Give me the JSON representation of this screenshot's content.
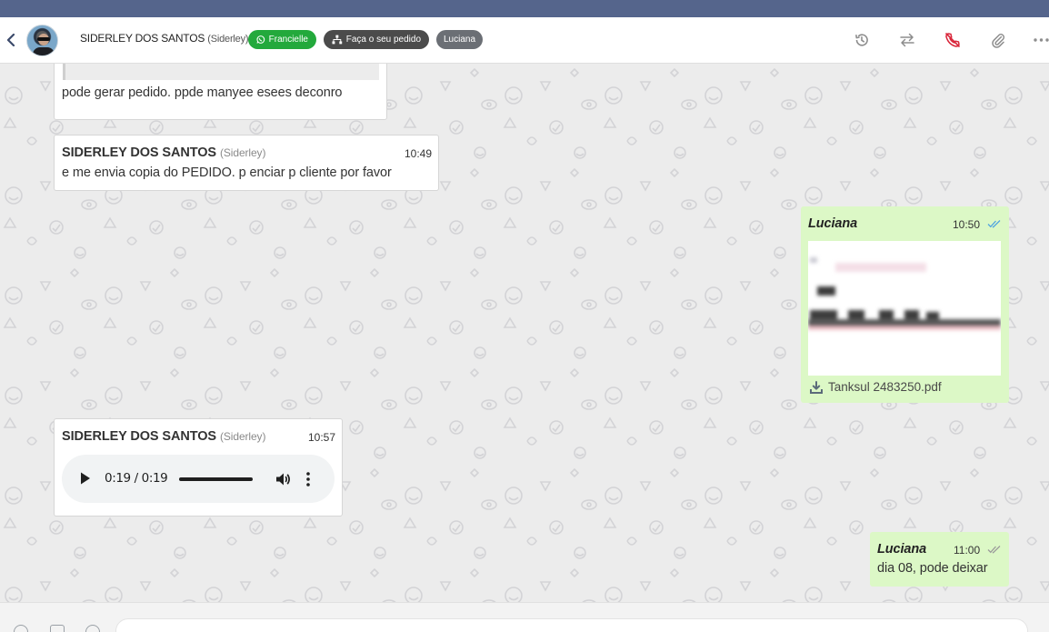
{
  "header": {
    "contact_name": "SIDERLEY DOS SANTOS",
    "contact_alias": "(Siderley)",
    "tags": [
      {
        "label": "Francielle",
        "color": "#23a93c",
        "icon": "whatsapp-icon"
      },
      {
        "label": "Faça o seu pedido",
        "color": "#4b4b4b",
        "icon": "sitemap-icon"
      },
      {
        "label": "Luciana",
        "color": "#6b6f75"
      }
    ],
    "actions": [
      "history-icon",
      "transfer-icon",
      "end-call-icon",
      "attach-icon",
      "more-icon"
    ]
  },
  "messages": [
    {
      "direction": "in",
      "text": "pode gerar pedido. ppde manyee esees deconro"
    },
    {
      "direction": "in",
      "sender": "SIDERLEY DOS SANTOS",
      "alias": "(Siderley)",
      "time": "10:49",
      "text": "e me envia copia do PEDIDO. p enciar p cliente por favor"
    },
    {
      "direction": "out",
      "sender": "Luciana",
      "time": "10:50",
      "attachment": "Tanksul 2483250.pdf",
      "status": "read"
    },
    {
      "direction": "in",
      "sender": "SIDERLEY DOS SANTOS",
      "alias": "(Siderley)",
      "time": "10:57",
      "audio": {
        "time": "0:19 / 0:19",
        "progress": 1.0
      }
    },
    {
      "direction": "out",
      "sender": "Luciana",
      "time": "11:00",
      "text": "dia 08, pode deixar",
      "status": "delivered"
    }
  ],
  "composer": {
    "value": "",
    "placeholder": ""
  },
  "colors": {
    "topbar": "#55658c",
    "outgoing_bubble": "#dcf8c6",
    "read_ticks": "#4fa3e0",
    "end_call": "#d9263a"
  }
}
